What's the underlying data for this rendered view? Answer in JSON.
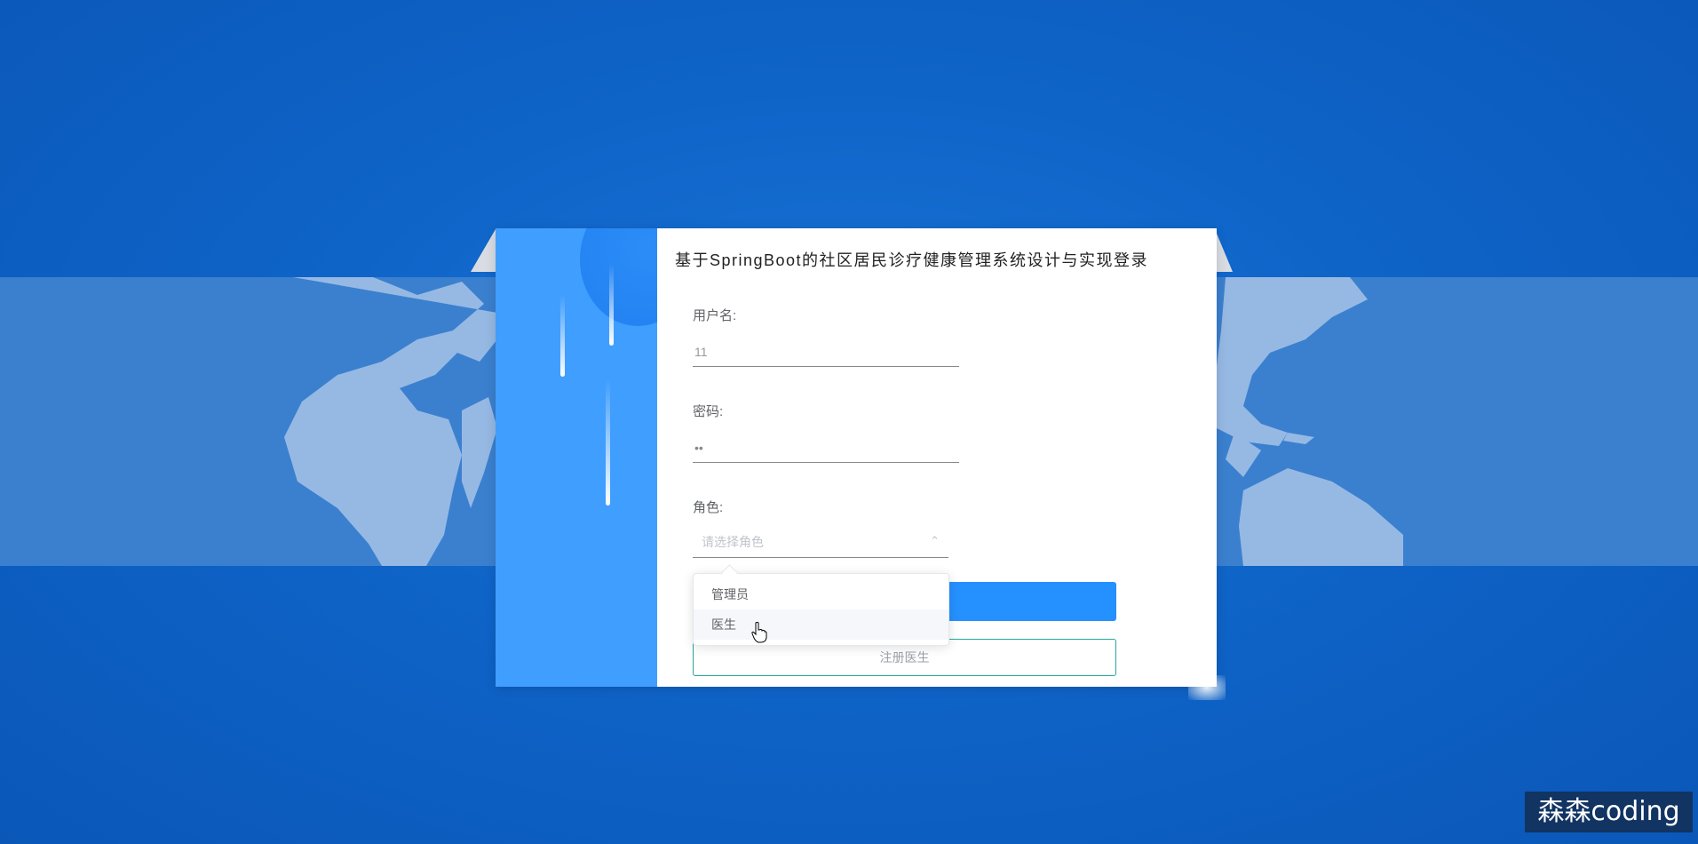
{
  "login": {
    "title": "基于SpringBoot的社区居民诊疗健康管理系统设计与实现登录",
    "username_label": "用户名:",
    "username_value": "11",
    "password_label": "密码:",
    "password_value": "••",
    "role_label": "角色:",
    "role_placeholder": "请选择角色",
    "register_label": "注册医生"
  },
  "role_dropdown": {
    "options": [
      "管理员",
      "医生"
    ],
    "hovered": "医生"
  },
  "watermark": "森森coding",
  "colors": {
    "primary": "#2590ff",
    "panel": "#409eff",
    "register_border": "#26a69a"
  },
  "icons": [
    "chevron-up-icon",
    "hand-cursor-icon"
  ]
}
